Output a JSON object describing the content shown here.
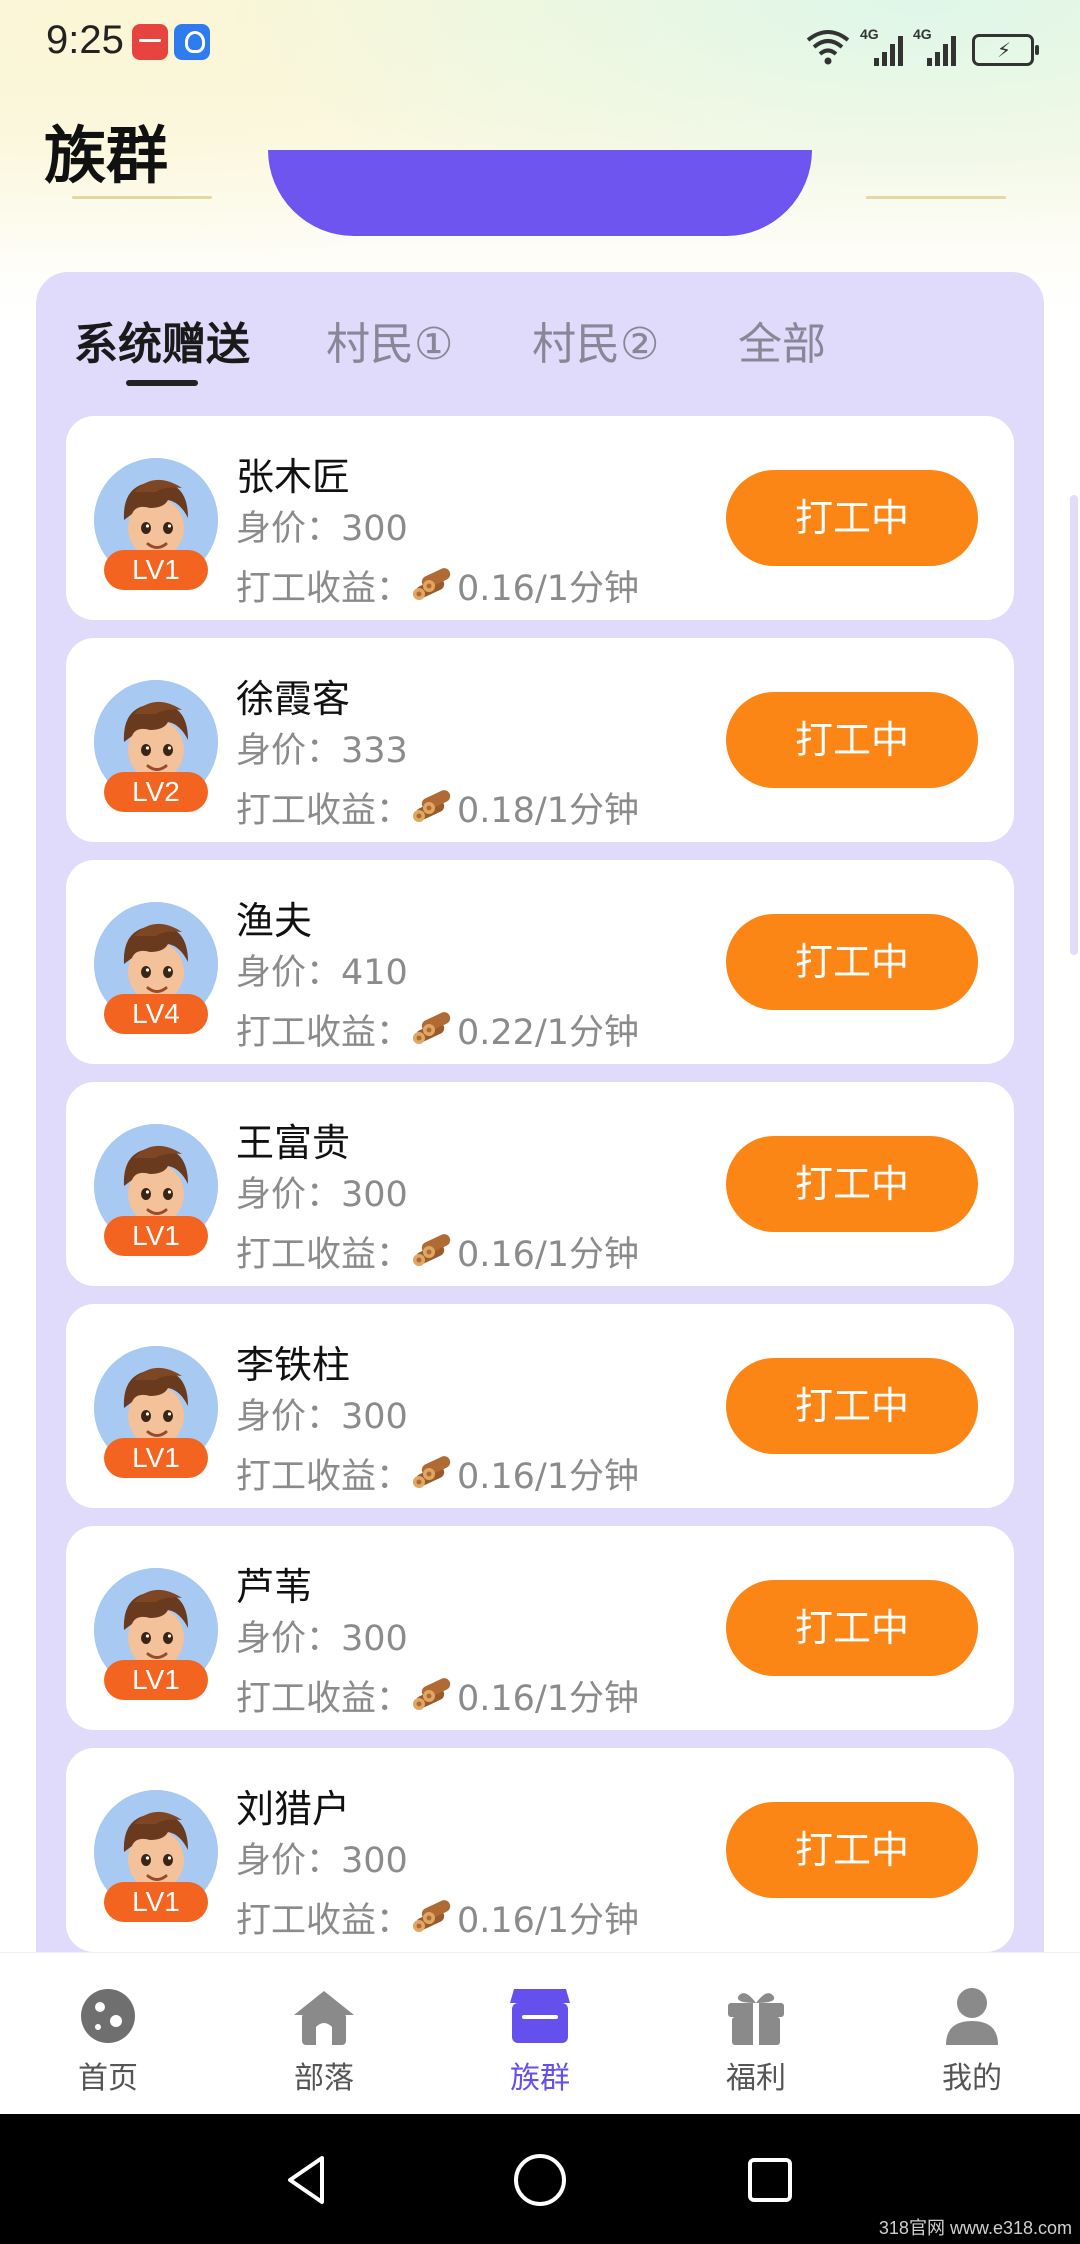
{
  "status": {
    "time": "9:25",
    "network_left": "4G",
    "network_right": "4G"
  },
  "page": {
    "title": "族群"
  },
  "tabs": [
    {
      "label": "系统赠送",
      "active": true
    },
    {
      "label": "村民①",
      "active": false
    },
    {
      "label": "村民②",
      "active": false
    },
    {
      "label": "全部",
      "active": false
    }
  ],
  "villagers": [
    {
      "name": "张木匠",
      "level": "LV1",
      "price_label": "身价：",
      "price": "300",
      "income_label": "打工收益：",
      "income": "0.16/1分钟",
      "button": "打工中"
    },
    {
      "name": "徐霞客",
      "level": "LV2",
      "price_label": "身价：",
      "price": "333",
      "income_label": "打工收益：",
      "income": "0.18/1分钟",
      "button": "打工中"
    },
    {
      "name": "渔夫",
      "level": "LV4",
      "price_label": "身价：",
      "price": "410",
      "income_label": "打工收益：",
      "income": "0.22/1分钟",
      "button": "打工中"
    },
    {
      "name": "王富贵",
      "level": "LV1",
      "price_label": "身价：",
      "price": "300",
      "income_label": "打工收益：",
      "income": "0.16/1分钟",
      "button": "打工中"
    },
    {
      "name": "李铁柱",
      "level": "LV1",
      "price_label": "身价：",
      "price": "300",
      "income_label": "打工收益：",
      "income": "0.16/1分钟",
      "button": "打工中"
    },
    {
      "name": "芦苇",
      "level": "LV1",
      "price_label": "身价：",
      "price": "300",
      "income_label": "打工收益：",
      "income": "0.16/1分钟",
      "button": "打工中"
    },
    {
      "name": "刘猎户",
      "level": "LV1",
      "price_label": "身价：",
      "price": "300",
      "income_label": "打工收益：",
      "income": "0.16/1分钟",
      "button": "打工中"
    }
  ],
  "bottom_nav": [
    {
      "label": "首页",
      "icon": "planet-icon",
      "active": false
    },
    {
      "label": "部落",
      "icon": "house-icon",
      "active": false
    },
    {
      "label": "族群",
      "icon": "store-icon",
      "active": true
    },
    {
      "label": "福利",
      "icon": "gift-icon",
      "active": false
    },
    {
      "label": "我的",
      "icon": "person-icon",
      "active": false
    }
  ],
  "watermark": "318官网 www.e318.com",
  "colors": {
    "accent": "#6e55f0",
    "panel": "#e0dbfb",
    "button": "#fb8616",
    "badge": "#f2641f"
  }
}
